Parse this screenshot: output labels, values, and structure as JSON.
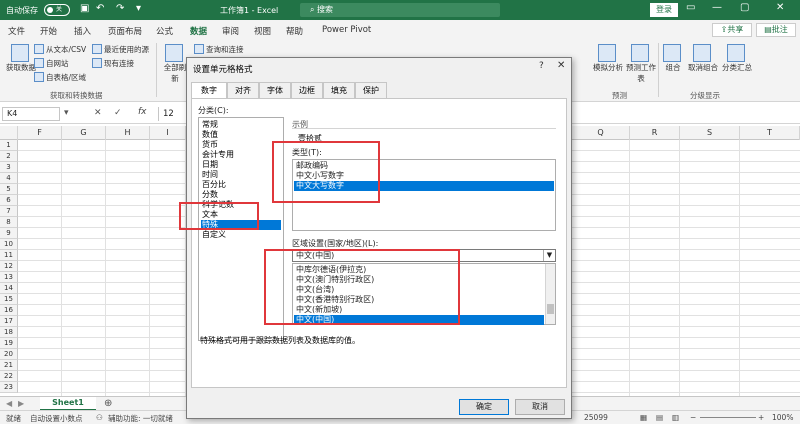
{
  "titlebar": {
    "autosave_label": "自动保存",
    "autosave_state": "关",
    "title": "工作簿1 - Excel",
    "search_placeholder": "搜索",
    "login_label": "登录",
    "min": "—",
    "restore": "▢",
    "close": "✕"
  },
  "tabs": [
    "文件",
    "开始",
    "插入",
    "页面布局",
    "公式",
    "数据",
    "审阅",
    "视图",
    "帮助",
    "Power Pivot"
  ],
  "active_tab": "数据",
  "share_label": "共享",
  "comments_label": "批注",
  "ribbon": {
    "get_data": "获取数据",
    "from_text": "从文本/CSV",
    "from_web": "自网站",
    "from_table": "自表格/区域",
    "recent": "最近使用的源",
    "existing": "现有连接",
    "group1": "获取和转换数据",
    "refresh": "全部刷新",
    "queries": "查询和连接",
    "whatif": "模拟分析",
    "forecast": "预测工作表",
    "group_forecast": "预测",
    "group_cmd": "组合",
    "ungroup": "取消组合",
    "subtotal": "分类汇总",
    "group_outline": "分级显示"
  },
  "formulabar": {
    "namebox": "K4",
    "cancel": "✕",
    "enter": "✓",
    "fx": "fx",
    "value": "12"
  },
  "grid": {
    "columns": [
      "F",
      "G",
      "H",
      "I",
      "Q",
      "R",
      "S",
      "T"
    ],
    "rows": [
      "1",
      "2",
      "3",
      "4",
      "5",
      "6",
      "7",
      "8",
      "9",
      "10",
      "11",
      "12",
      "13",
      "14",
      "15",
      "16",
      "17",
      "18",
      "19",
      "20",
      "21",
      "22",
      "23"
    ]
  },
  "sheet": {
    "tab": "Sheet1",
    "add": "⊕"
  },
  "status": {
    "ready": "就绪",
    "autodec": "自动设置小数点",
    "accessibility": "辅助功能: 一切就绪",
    "count": "25099",
    "zoom": "100%"
  },
  "dialog": {
    "title": "设置单元格格式",
    "help": "?",
    "close": "✕",
    "tabs": [
      "数字",
      "对齐",
      "字体",
      "边框",
      "填充",
      "保护"
    ],
    "category_label": "分类(C):",
    "categories": [
      "常规",
      "数值",
      "货币",
      "会计专用",
      "日期",
      "时间",
      "百分比",
      "分数",
      "科学记数",
      "文本",
      "特殊",
      "自定义"
    ],
    "selected_category": "特殊",
    "sample_label": "示例",
    "sample_value": "壹拾贰",
    "type_label": "类型(T):",
    "types": [
      "邮政编码",
      "中文小写数字",
      "中文大写数字"
    ],
    "selected_type": "中文大写数字",
    "locale_label": "区域设置(国家/地区)(L):",
    "locale_value": "中文(中国)",
    "locales": [
      "中库尔德语(伊拉克)",
      "中文(澳门特别行政区)",
      "中文(台湾)",
      "中文(香港特别行政区)",
      "中文(新加坡)",
      "中文(中国)"
    ],
    "selected_locale": "中文(中国)",
    "description": "特殊格式可用于跟踪数据列表及数据库的值。",
    "ok": "确定",
    "cancel": "取消"
  },
  "colors": {
    "excel_green": "#217346",
    "selection_blue": "#0078d7",
    "highlight_red": "#e0373b"
  }
}
